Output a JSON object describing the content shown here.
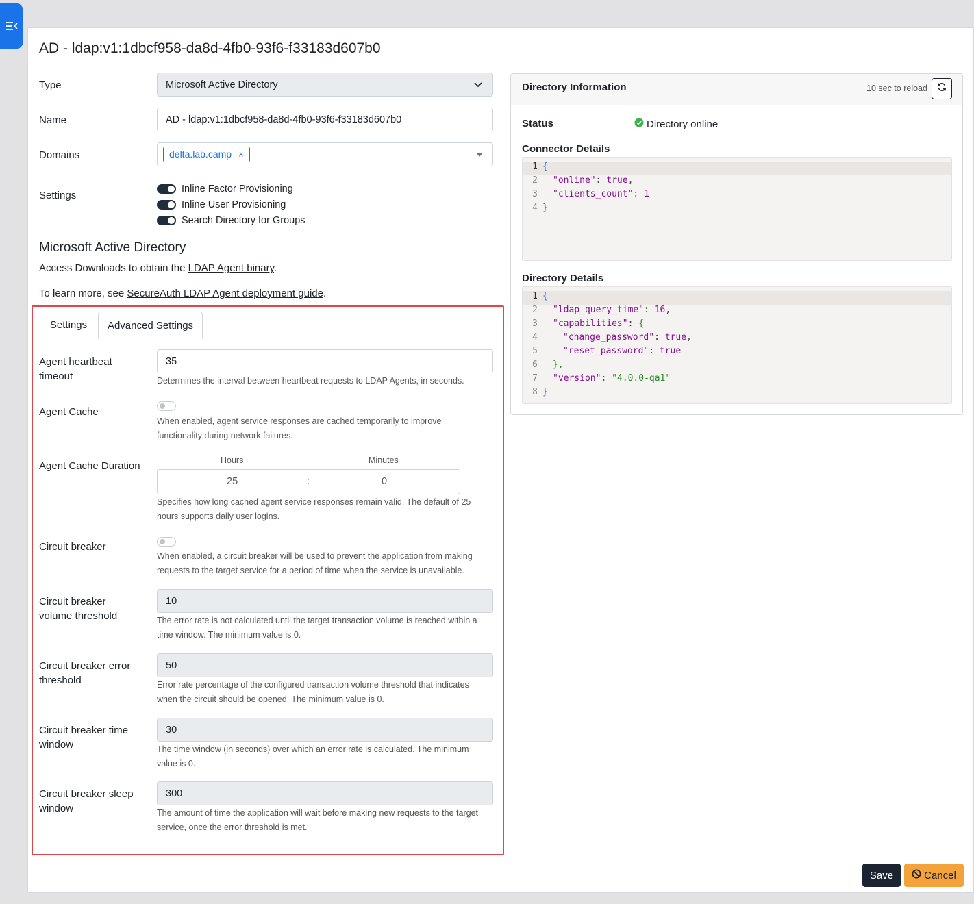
{
  "app": {
    "toggle_icon": "collapse-sidebar-icon",
    "accent": "#1a73e8"
  },
  "page": {
    "title": "AD - ldap:v1:1dbcf958-da8d-4fb0-93f6-f33183d607b0"
  },
  "form": {
    "type_label": "Type",
    "type_value": "Microsoft Active Directory",
    "name_label": "Name",
    "name_value": "AD - ldap:v1:1dbcf958-da8d-4fb0-93f6-f33183d607b0",
    "domains_label": "Domains",
    "domain_tag": "delta.lab.camp",
    "domain_remove": "×",
    "settings_label": "Settings",
    "toggles": [
      {
        "label": "Inline Factor Provisioning",
        "on": true
      },
      {
        "label": "Inline User Provisioning",
        "on": true
      },
      {
        "label": "Search Directory for Groups",
        "on": true
      }
    ]
  },
  "section": {
    "title": "Microsoft Active Directory",
    "downloads_prefix": "Access Downloads to obtain the ",
    "downloads_link": "LDAP Agent binary",
    "downloads_suffix": ".",
    "learn_prefix": "To learn more, see ",
    "learn_link": "SecureAuth LDAP Agent deployment guide",
    "learn_suffix": "."
  },
  "tabs": [
    {
      "label": "Settings",
      "active": false
    },
    {
      "label": "Advanced Settings",
      "active": true
    }
  ],
  "advanced": {
    "heartbeat_label_1": "Agent heartbeat",
    "heartbeat_label_2": "timeout",
    "heartbeat_value": "35",
    "heartbeat_help": "Determines the interval between heartbeat requests to LDAP Agents, in seconds.",
    "cache_label": "Agent Cache",
    "cache_on": false,
    "cache_help_1": "When enabled, agent service responses are cached temporarily to improve",
    "cache_help_2": "functionality during network failures.",
    "duration_label": "Agent Cache Duration",
    "hours_label": "Hours",
    "minutes_label": "Minutes",
    "hours_value": "25",
    "separator": ":",
    "minutes_value": "0",
    "duration_help_1": "Specifies how long cached agent service responses remain valid. The default of 25",
    "duration_help_2": "hours supports daily user logins.",
    "cb_label": "Circuit breaker",
    "cb_on": false,
    "cb_help_1": "When enabled, a circuit breaker will be used to prevent the application from making",
    "cb_help_2": "requests to the target service for a period of time when the service is unavailable.",
    "vol_label_1": "Circuit breaker",
    "vol_label_2": "volume threshold",
    "vol_value": "10",
    "vol_help_1": "The error rate is not calculated until the target transaction volume is reached within a",
    "vol_help_2": "time window. The minimum value is 0.",
    "err_label_1": "Circuit breaker error",
    "err_label_2": "threshold",
    "err_value": "50",
    "err_help_1": "Error rate percentage of the configured transaction volume threshold that indicates",
    "err_help_2": "when the circuit should be opened. The minimum value is 0.",
    "time_label_1": "Circuit breaker time",
    "time_label_2": "window",
    "time_value": "30",
    "time_help_1": "The time window (in seconds) over which an error rate is calculated. The minimum",
    "time_help_2": "value is 0.",
    "sleep_label_1": "Circuit breaker sleep",
    "sleep_label_2": "window",
    "sleep_value": "300",
    "sleep_help_1": "The amount of time the application will wait before making new requests to the target",
    "sleep_help_2": "service, once the error threshold is met."
  },
  "directory_info": {
    "title": "Directory Information",
    "reload_text": "10 sec to reload",
    "reload_icon": "refresh-icon",
    "status_label": "Status",
    "status_value": "Directory online",
    "status_icon": "check-circle-icon",
    "connector_label": "Connector Details",
    "connector_lines": [
      "1",
      "2",
      "3",
      "4"
    ],
    "connector_code": {
      "open": "{",
      "online_key": "\"online\"",
      "online_val": "true",
      "clients_key": "\"clients_count\"",
      "clients_val": "1",
      "close": "}"
    },
    "details_label": "Directory Details",
    "details_lines": [
      "1",
      "2",
      "3",
      "4",
      "5",
      "6",
      "7",
      "8"
    ],
    "details_code": {
      "open": "{",
      "query_key": "\"ldap_query_time\"",
      "query_val": "16",
      "cap_key": "\"capabilities\"",
      "cap_open": "{",
      "change_key": "\"change_password\"",
      "change_val": "true",
      "reset_key": "\"reset_password\"",
      "reset_val": "true",
      "cap_close": "},",
      "version_key": "\"version\"",
      "version_val": "\"4.0.0-qa1\"",
      "close": "}"
    }
  },
  "footer": {
    "save_label": "Save",
    "cancel_label": "Cancel",
    "cancel_icon": "ban-icon"
  }
}
